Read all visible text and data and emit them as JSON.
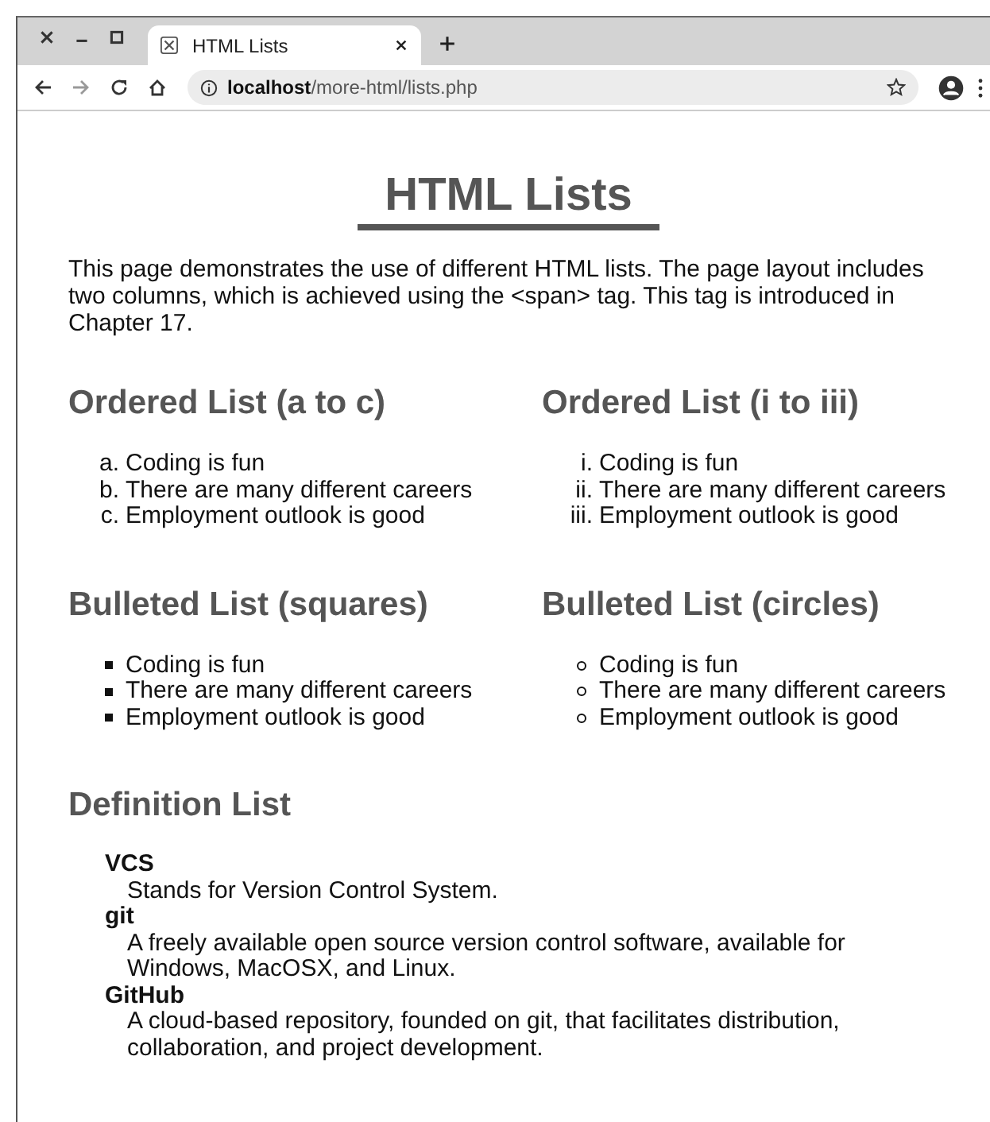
{
  "browser": {
    "tab": {
      "title": "HTML Lists"
    },
    "address": "**localhost**/more-html/lists.php"
  },
  "page": {
    "title": "HTML Lists",
    "intro": "This page demonstrates the use of different HTML lists. The page layout includes two columns, which is achieved using the <span> tag. This tag is introduced in Chapter 17.",
    "sections": [
      {
        "heading": "Ordered List (a to c)",
        "kind": "ordered",
        "items": [
          {
            "marker": "a.",
            "text": "Coding is fun"
          },
          {
            "marker": "b.",
            "text": "There are many different careers"
          },
          {
            "marker": "c.",
            "text": "Employment outlook is good"
          }
        ]
      },
      {
        "heading": "Ordered List (i to iii)",
        "kind": "ordered",
        "items": [
          {
            "marker": "i.",
            "text": "Coding is fun"
          },
          {
            "marker": "ii.",
            "text": "There are many different careers"
          },
          {
            "marker": "iii.",
            "text": "Employment outlook is good"
          }
        ]
      },
      {
        "heading": "Bulleted List (squares)",
        "kind": "square",
        "items": [
          {
            "text": "Coding is fun"
          },
          {
            "text": "There are many different careers"
          },
          {
            "text": "Employment outlook is good"
          }
        ]
      },
      {
        "heading": "Bulleted List (circles)",
        "kind": "circle",
        "items": [
          {
            "text": "Coding is fun"
          },
          {
            "text": "There are many different careers"
          },
          {
            "text": "Employment outlook is good"
          }
        ]
      }
    ],
    "definitions": {
      "heading": "Definition List",
      "terms": [
        {
          "term": "VCS",
          "description": "Stands for Version Control System."
        },
        {
          "term": "git",
          "description": "A freely available open source version control software, available for Windows, MacOSX, and Linux."
        },
        {
          "term": "GitHub",
          "description": "A cloud-based repository, founded on git, that facilitates distribution, collaboration, and project development."
        }
      ]
    }
  }
}
